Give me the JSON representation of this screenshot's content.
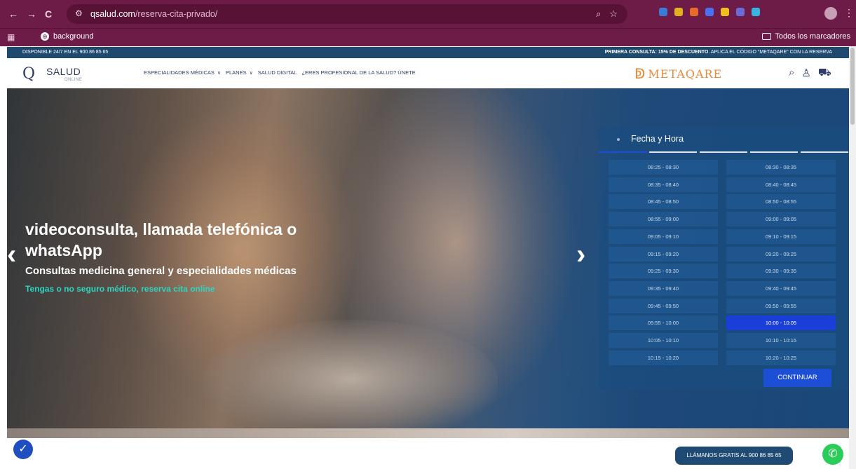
{
  "browser": {
    "nav": {
      "back": "←",
      "forward": "→",
      "reload": "C"
    },
    "url_host": "qsalud.com",
    "url_path": "/reserva-cita-privado/",
    "bookmark_apps_icon": "apps-grid-icon",
    "bookmark_label": "background",
    "bookmark_globe": "⊕",
    "all_bookmarks": "Todos los marcadores",
    "omni_icons": [
      "zoom-icon",
      "star-icon"
    ],
    "extension_colors": [
      "#3a7bd5",
      "#e0b020",
      "#e66a2a",
      "#4a6ff0",
      "#f0c020",
      "#6b6bd8",
      "#39b6e0"
    ]
  },
  "site": {
    "topbar_left": "DISPONIBLE 24/7 EN EL 900 86 85 65",
    "topbar_right_bold": "PRIMERA CONSULTA: 15% DE DESCUENTO",
    "topbar_right_rest": ". APLICA EL CÓDIGO \"METAQARE\" CON LA RESERVA",
    "logo_mark": "Q",
    "logo_text": "SALUD",
    "logo_sub": "ONLINE",
    "menu": [
      {
        "label": "ESPECIALIDADES MÉDICAS",
        "has_dropdown": true,
        "chevron": "∨"
      },
      {
        "label": "PLANES",
        "has_dropdown": true,
        "chevron": "∨"
      },
      {
        "label": "SALUD DIGITAL",
        "has_dropdown": false
      },
      {
        "label": "¿ERES PROFESIONAL DE LA SALUD? ÚNETE",
        "has_dropdown": false
      }
    ],
    "partner_logo_text": "METAQARE",
    "header_icons": {
      "search": "⌕",
      "user": "♙",
      "cart": "⛟"
    }
  },
  "hero": {
    "title": "videoconsulta, llamada telefónica o whatsApp",
    "subtitle": "Consultas medicina general y especialidades médicas",
    "cta": "Tengas o no seguro médico, reserva cita online",
    "prev_arrow": "‹",
    "next_arrow": "›",
    "cta_color": "#2fd3c0"
  },
  "booking": {
    "step_title": "Fecha y Hora",
    "slots_left": [
      "08:25 - 08:30",
      "08:35 - 08:40",
      "08:45 - 08:50",
      "08:55 - 09:00",
      "09:05 - 09:10",
      "09:15 - 09:20",
      "09:25 - 09:30",
      "09:35 - 09:40",
      "09:45 - 09:50",
      "09:55 - 10:00",
      "10:05 - 10:10",
      "10:15 - 10:20"
    ],
    "slots_right": [
      "08:30 - 08:35",
      "08:40 - 08:45",
      "08:50 - 08:55",
      "09:00 - 09:05",
      "09:10 - 09:15",
      "09:20 - 09:25",
      "09:30 - 09:35",
      "09:40 - 09:45",
      "09:50 - 09:55",
      "10:00 - 10:05",
      "10:10 - 10:15",
      "10:20 - 10:25"
    ],
    "selected_slot": "10:00 - 10:05",
    "continue_label": "CONTINUAR",
    "selected_color": "#1a3fd9"
  },
  "footer": {
    "accessibility_icon": "✓",
    "call_label": "LLÁMANOS GRATIS AL 900 86 85 65",
    "whatsapp_icon": "✆",
    "whatsapp_color": "#2ccc5b"
  }
}
